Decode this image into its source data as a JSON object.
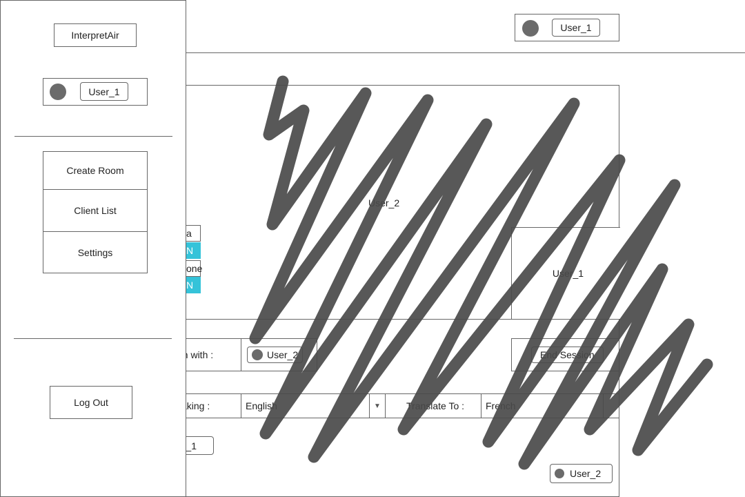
{
  "header": {
    "user_label": "User_1"
  },
  "sidebar": {
    "brand": "InterpretAir",
    "user_label": "User_1",
    "menu": [
      {
        "label": "Create Room"
      },
      {
        "label": "Client List"
      },
      {
        "label": "Settings"
      }
    ],
    "logout_label": "Log Out"
  },
  "stage": {
    "remote_user_label": "User_2",
    "self_view_label": "User_1",
    "participants": [
      {
        "name": "a",
        "status": "N"
      },
      {
        "name": "one",
        "status": "N"
      }
    ]
  },
  "session": {
    "with_label": "on with :",
    "with_user": "User_2",
    "end_button": "End Session"
  },
  "languages": {
    "speaking_label": "aking :",
    "speaking_value": "English",
    "translate_label": "Translate To :",
    "translate_value": "French"
  },
  "footer": {
    "self_chip": "r_1",
    "other_chip": "User_2"
  },
  "colors": {
    "accent": "#35c3d9",
    "scribble": "#4a4a4a"
  }
}
